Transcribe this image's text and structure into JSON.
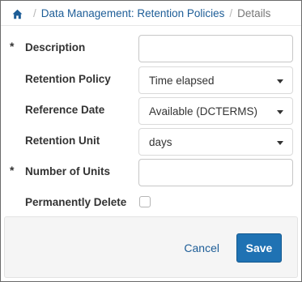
{
  "breadcrumb": {
    "home_icon": "home-icon",
    "separator": "/",
    "link": "Data Management: Retention Policies",
    "current": "Details"
  },
  "form": {
    "required_marker": "*",
    "description": {
      "label": "Description",
      "value": ""
    },
    "retention_policy": {
      "label": "Retention Policy",
      "value": "Time elapsed"
    },
    "reference_date": {
      "label": "Reference Date",
      "value": "Available (DCTERMS)"
    },
    "retention_unit": {
      "label": "Retention Unit",
      "value": "days"
    },
    "number_of_units": {
      "label": "Number of Units",
      "value": ""
    },
    "permanently_delete": {
      "label": "Permanently Delete",
      "checked": false
    }
  },
  "footer": {
    "cancel_label": "Cancel",
    "save_label": "Save"
  },
  "colors": {
    "link": "#1d5d97",
    "primary_button": "#1f72b3",
    "footer_bg": "#f5f5f5"
  }
}
